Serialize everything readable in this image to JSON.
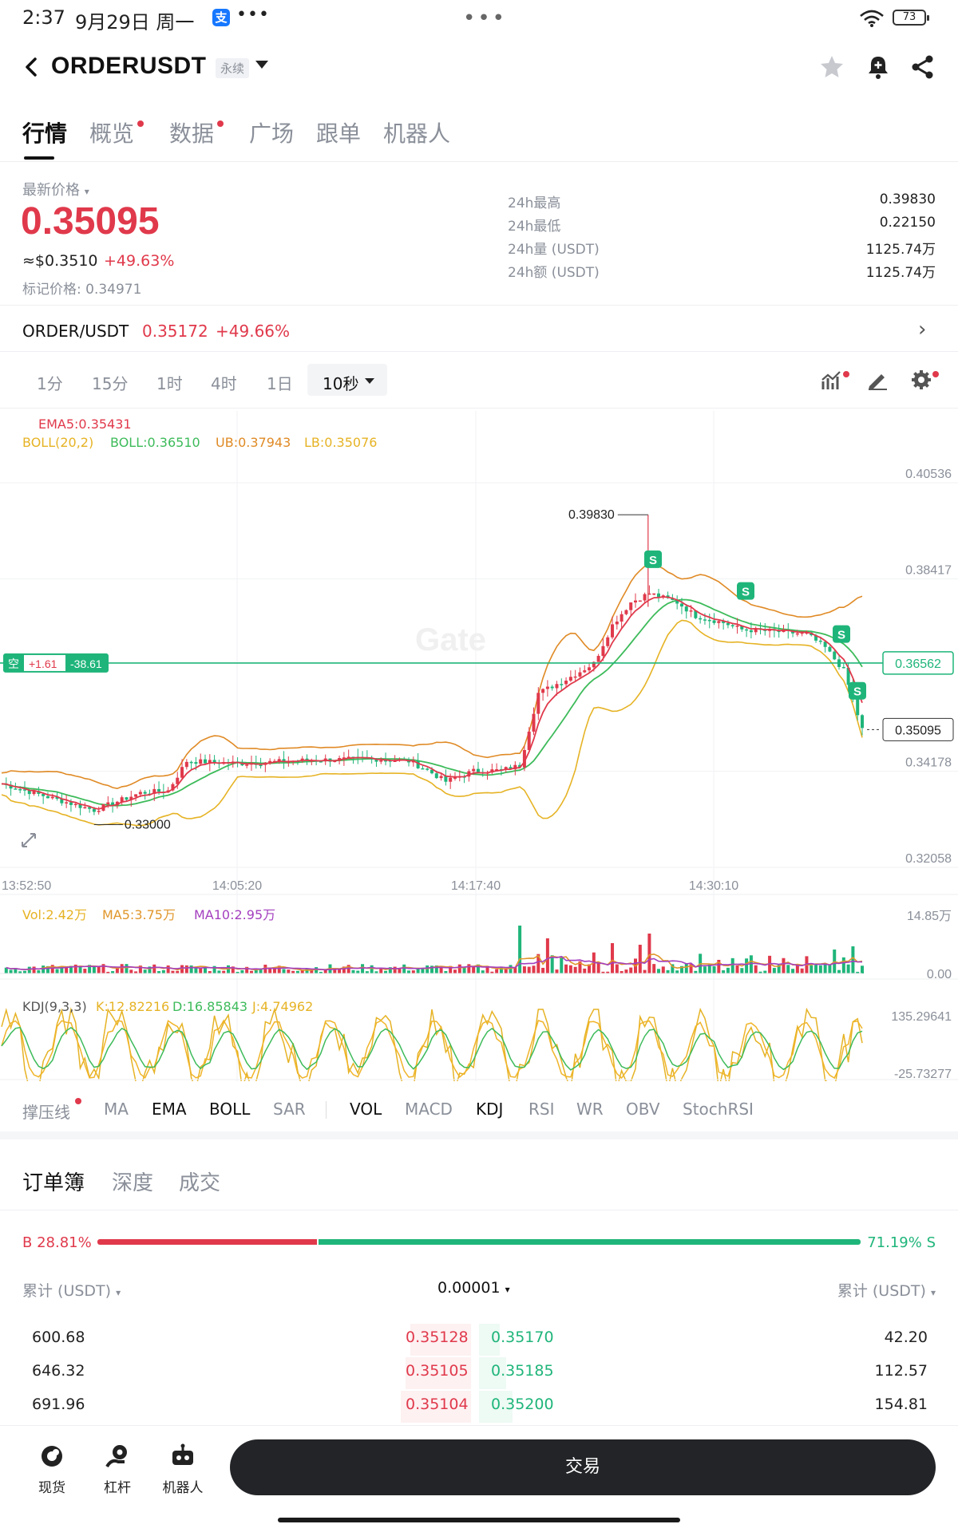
{
  "status_bar": {
    "time": "2:37",
    "date": "9月29日 周一",
    "alipay_glyph": "支",
    "more": "•••",
    "center_dots": "•••",
    "battery": "73"
  },
  "header": {
    "symbol": "ORDERUSDT",
    "contract_type": "永续",
    "icons": [
      "back-icon",
      "star-icon",
      "bell-plus-icon",
      "share-icon"
    ]
  },
  "tabs": [
    {
      "label": "行情",
      "active": true,
      "dot": false
    },
    {
      "label": "概览",
      "active": false,
      "dot": true
    },
    {
      "label": "数据",
      "active": false,
      "dot": true
    },
    {
      "label": "广场",
      "active": false,
      "dot": false
    },
    {
      "label": "跟单",
      "active": false,
      "dot": false
    },
    {
      "label": "机器人",
      "active": false,
      "dot": false
    }
  ],
  "price": {
    "label": "最新价格",
    "last": "0.35095",
    "usd": "≈$0.3510",
    "change_pct": "+49.63%",
    "mark_label": "标记价格: 0.34971"
  },
  "stats": [
    {
      "label": "24h最高",
      "value": "0.39830"
    },
    {
      "label": "24h最低",
      "value": "0.22150"
    },
    {
      "label": "24h量 (USDT)",
      "value": "1125.74万"
    },
    {
      "label": "24h额 (USDT)",
      "value": "1125.74万"
    }
  ],
  "spot": {
    "pair": "ORDER/USDT",
    "price": "0.35172",
    "change": "+49.66%"
  },
  "intervals": [
    "1分",
    "15分",
    "1时",
    "4时",
    "1日"
  ],
  "interval_active": "10秒",
  "chart": {
    "legend_ema": "EMA5:0.35431",
    "legend_boll": "BOLL(20,2)",
    "legend_boll_mid": "BOLL:0.36510",
    "legend_ub": "UB:0.37943",
    "legend_lb": "LB:0.35076",
    "y_ticks": [
      "0.40536",
      "0.38417",
      "0.34178",
      "0.32058"
    ],
    "x_ticks": [
      "13:52:50",
      "14:05:20",
      "14:17:40",
      "14:30:10"
    ],
    "high_mark": "0.39830",
    "low_mark": "0.33000",
    "position_tag": {
      "side": "空",
      "qty": "+1.61",
      "pnl": "-38.61"
    },
    "position_price": "0.36562",
    "last_price_tag": "0.35095",
    "signal_labels": [
      "S",
      "S",
      "S",
      "S"
    ],
    "watermark": "Gate"
  },
  "volume": {
    "vol": "Vol:2.42万",
    "ma5": "MA5:3.75万",
    "ma10": "MA10:2.95万",
    "y_top": "14.85万",
    "y_bottom": "0.00"
  },
  "kdj": {
    "title": "KDJ(9,3,3)",
    "k": "K:12.82216",
    "d": "D:16.85843",
    "j": "J:4.74962",
    "y_top": "135.29641",
    "y_bottom": "-25.73277"
  },
  "indicators": [
    {
      "label": "撑压线",
      "on": false,
      "dot": true
    },
    {
      "label": "MA",
      "on": false
    },
    {
      "label": "EMA",
      "on": true
    },
    {
      "label": "BOLL",
      "on": true
    },
    {
      "label": "SAR",
      "on": false
    },
    {
      "label": "VOL",
      "on": true
    },
    {
      "label": "MACD",
      "on": false
    },
    {
      "label": "KDJ",
      "on": true
    },
    {
      "label": "RSI",
      "on": false
    },
    {
      "label": "WR",
      "on": false
    },
    {
      "label": "OBV",
      "on": false
    },
    {
      "label": "StochRSI",
      "on": false
    }
  ],
  "orderbook": {
    "tabs": [
      "订单簿",
      "深度",
      "成交"
    ],
    "buy_ratio": "B 28.81%",
    "sell_ratio": "71.19% S",
    "buy_fraction": 0.2881,
    "col_left": "累计 (USDT)",
    "col_mid": "0.00001",
    "col_right": "累计 (USDT)",
    "rows": [
      {
        "bid_total": "600.68",
        "bid": "0.35128",
        "ask": "0.35170",
        "ask_total": "42.20"
      },
      {
        "bid_total": "646.32",
        "bid": "0.35105",
        "ask": "0.35185",
        "ask_total": "112.57"
      },
      {
        "bid_total": "691.96",
        "bid": "0.35104",
        "ask": "0.35200",
        "ask_total": "154.81"
      }
    ]
  },
  "bottom_nav": [
    {
      "label": "现货",
      "icon": "spot-icon"
    },
    {
      "label": "杠杆",
      "icon": "leverage-icon"
    },
    {
      "label": "机器人",
      "icon": "robot-icon"
    }
  ],
  "trade_button": "交易",
  "colors": {
    "up": "#e0394b",
    "down": "#1fb57a",
    "ema": "#e0394b",
    "boll_mid": "#3dbb5a",
    "boll_band": "#e6b325",
    "ma10": "#a43fbf"
  }
}
